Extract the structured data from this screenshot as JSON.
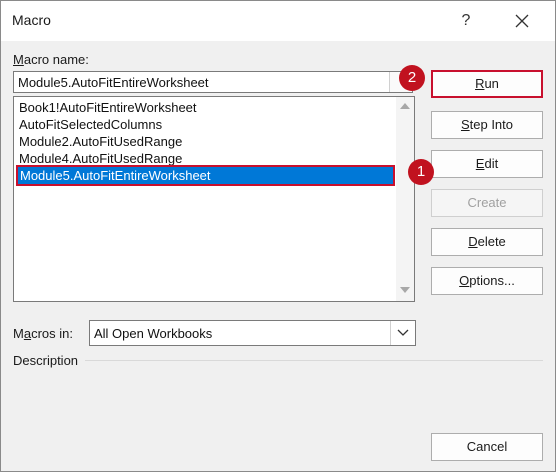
{
  "window": {
    "title": "Macro",
    "help_glyph": "?"
  },
  "macro_name": {
    "label_accel": "M",
    "label_rest": "acro name:",
    "value": "Module5.AutoFitEntireWorksheet"
  },
  "macro_list": {
    "items": [
      "Book1!AutoFitEntireWorksheet",
      "AutoFitSelectedColumns",
      "Module2.AutoFitUsedRange",
      "Module4.AutoFitUsedRange",
      "Module5.AutoFitEntireWorksheet"
    ],
    "selected_index": 4
  },
  "buttons": {
    "run": {
      "accel": "R",
      "rest": "un"
    },
    "step_into": {
      "accel": "S",
      "rest": "tep Into"
    },
    "edit": {
      "accel": "E",
      "rest": "dit"
    },
    "create": {
      "label": "Create"
    },
    "delete": {
      "accel": "D",
      "rest": "elete"
    },
    "options": {
      "accel": "O",
      "rest": "ptions..."
    },
    "cancel": {
      "label": "Cancel"
    }
  },
  "macros_in": {
    "label_pre": "M",
    "label_accel": "a",
    "label_post": "cros in:",
    "value": "All Open Workbooks"
  },
  "description": {
    "label": "Description"
  },
  "annotations": {
    "badge_1": "1",
    "badge_2": "2",
    "color": "#c1121f"
  },
  "colors": {
    "selection": "#0078d7",
    "highlight_border": "#c8102e",
    "dialog_bg": "#f0f0f0"
  },
  "icons": [
    "close-icon",
    "help-icon",
    "scroll-up-icon",
    "scroll-down-icon",
    "dropdown-arrow-icon"
  ]
}
